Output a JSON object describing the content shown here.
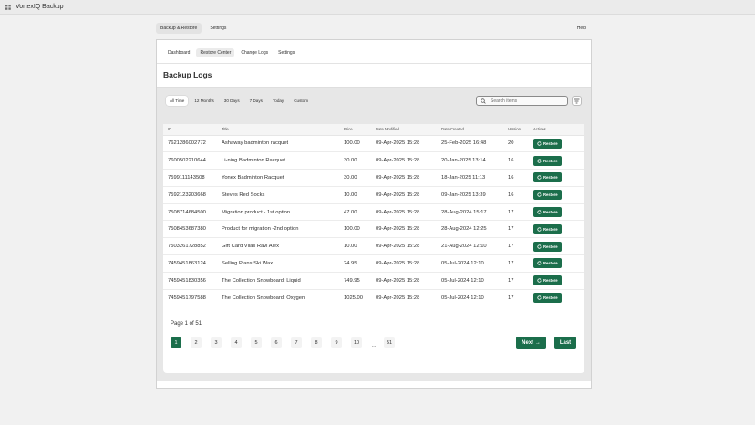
{
  "app": {
    "title": "VortexIQ Backup"
  },
  "main_tabs": [
    {
      "label": "Backup & Restore",
      "active": true
    },
    {
      "label": "Settings",
      "active": false
    }
  ],
  "help_label": "Help",
  "sub_tabs": [
    {
      "label": "Dashboard",
      "active": false
    },
    {
      "label": "Restore Center",
      "active": true
    },
    {
      "label": "Change Logs",
      "active": false
    },
    {
      "label": "Settings",
      "active": false
    }
  ],
  "page_title": "Backup Logs",
  "filters": [
    {
      "label": "All Time",
      "active": true
    },
    {
      "label": "12 Months",
      "active": false
    },
    {
      "label": "30 Days",
      "active": false
    },
    {
      "label": "7 Days",
      "active": false
    },
    {
      "label": "Today",
      "active": false
    },
    {
      "label": "Custom",
      "active": false
    }
  ],
  "search": {
    "placeholder": "Search items",
    "icon": "search-icon"
  },
  "filter_button_icon": "filter-icon",
  "table": {
    "headers": [
      "ID",
      "Title",
      "Price",
      "Date Modified",
      "Date Created",
      "Version",
      "Actions"
    ],
    "action_label": "Restore",
    "rows": [
      [
        "7621286002772",
        "Ashaway badminton racquet",
        "100.00",
        "09-Apr-2025 15:28",
        "25-Feb-2025 16:48",
        "20"
      ],
      [
        "7600502210644",
        "Li-ning Badminton Racquet",
        "30.00",
        "09-Apr-2025 15:28",
        "20-Jan-2025 13:14",
        "16"
      ],
      [
        "7599111143508",
        "Yonex Badminton Racquet",
        "30.00",
        "09-Apr-2025 15:28",
        "18-Jan-2025 11:13",
        "16"
      ],
      [
        "7592123203668",
        "Steves Red Socks",
        "10.00",
        "09-Apr-2025 15:28",
        "09-Jan-2025 13:39",
        "16"
      ],
      [
        "7508714684500",
        "Migration product - 1st option",
        "47.00",
        "09-Apr-2025 15:28",
        "28-Aug-2024 15:17",
        "17"
      ],
      [
        "7508453687380",
        "Product for migration -2nd option",
        "100.00",
        "09-Apr-2025 15:28",
        "28-Aug-2024 12:25",
        "17"
      ],
      [
        "7503261728852",
        "Gift Card Vilas Ravi Alex",
        "10.00",
        "09-Apr-2025 15:28",
        "21-Aug-2024 12:10",
        "17"
      ],
      [
        "7459451863124",
        "Selling Plans Ski Wax",
        "24.95",
        "09-Apr-2025 15:28",
        "05-Jul-2024 12:10",
        "17"
      ],
      [
        "7459451830356",
        "The Collection Snowboard: Liquid",
        "749.95",
        "09-Apr-2025 15:28",
        "05-Jul-2024 12:10",
        "17"
      ],
      [
        "7459451797588",
        "The Collection Snowboard: Oxygen",
        "1025.00",
        "09-Apr-2025 15:28",
        "05-Jul-2024 12:10",
        "17"
      ]
    ]
  },
  "pagination": {
    "info": "Page 1 of 51",
    "pages": [
      "1",
      "2",
      "3",
      "4",
      "5",
      "6",
      "7",
      "8",
      "9",
      "10"
    ],
    "current": "1",
    "ellipsis": "...",
    "last_page": "51",
    "next_label": "Next →",
    "last_label": "Last"
  },
  "colors": {
    "primary": "#1b6e4b",
    "background": "#f1f1f1"
  }
}
